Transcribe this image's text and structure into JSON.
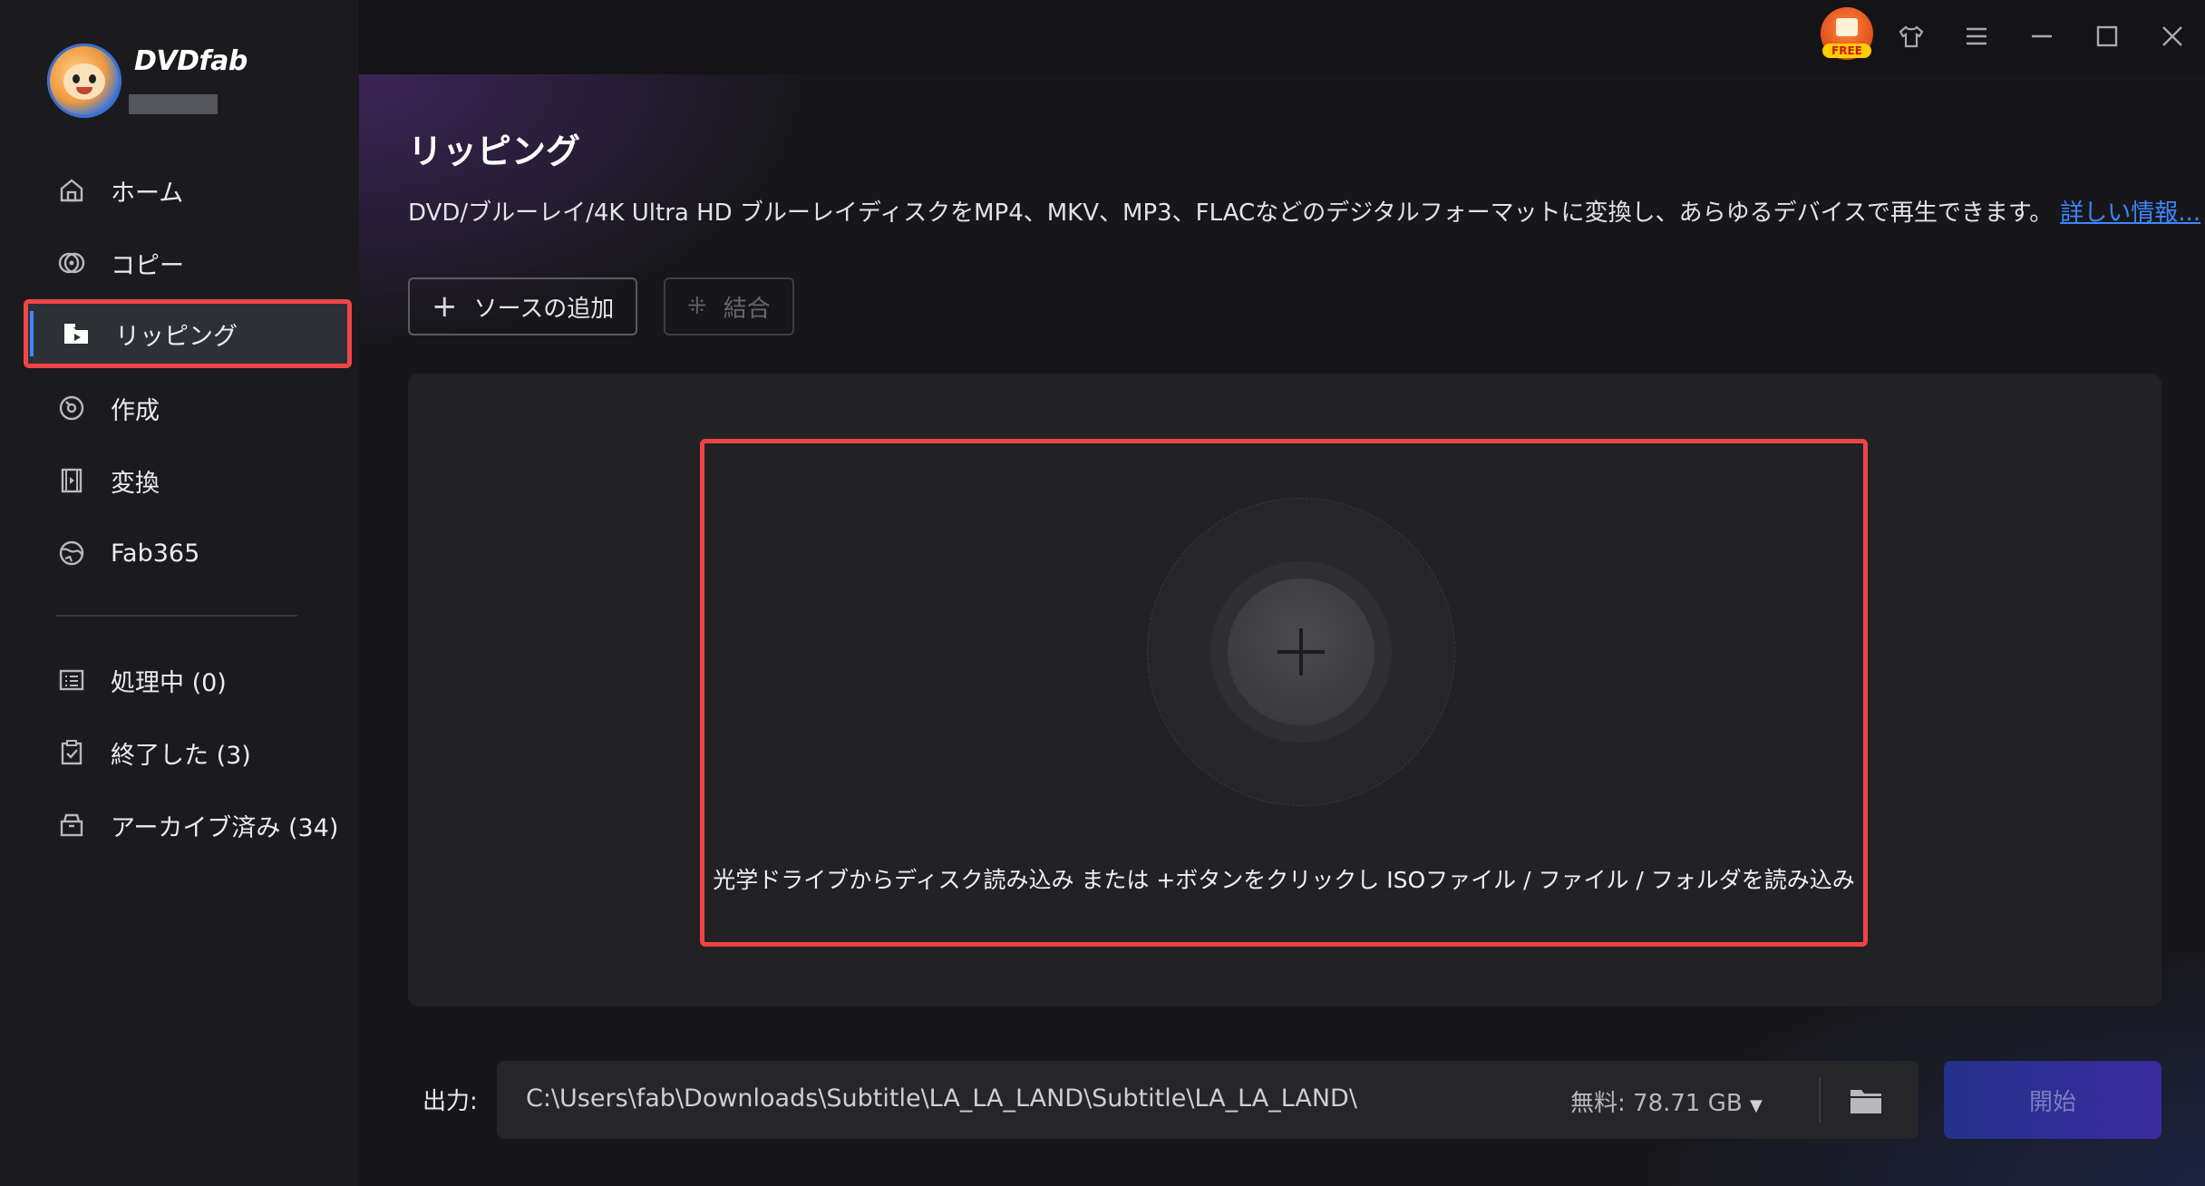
{
  "app": {
    "logo_text": "DVDfab"
  },
  "sidebar": {
    "items": [
      {
        "label": "ホーム",
        "icon": "home-icon"
      },
      {
        "label": "コピー",
        "icon": "copy-disc-icon"
      },
      {
        "label": "リッピング",
        "icon": "ripper-icon",
        "active": true
      },
      {
        "label": "作成",
        "icon": "creator-disc-icon"
      },
      {
        "label": "変換",
        "icon": "film-convert-icon"
      },
      {
        "label": "Fab365",
        "icon": "fab365-icon"
      }
    ],
    "queue": [
      {
        "label": "処理中 (0)",
        "icon": "task-list-icon"
      },
      {
        "label": "終了した (3)",
        "icon": "finished-clipboard-icon"
      },
      {
        "label": "アーカイブ済み (34)",
        "icon": "archive-box-icon"
      }
    ]
  },
  "topbar": {
    "free_badge": "FREE",
    "icons": [
      "free-gift-icon",
      "skin-shirt-icon",
      "menu-icon",
      "minimize-icon",
      "maximize-icon",
      "close-icon"
    ]
  },
  "main": {
    "title": "リッピング",
    "description": "DVD/ブルーレイ/4K Ultra HD ブルーレイディスクをMP4、MKV、MP3、FLACなどのデジタルフォーマットに変換し、あらゆるデバイスで再生できます。",
    "more_link": "詳しい情報...",
    "add_source_label": "ソースの追加",
    "merge_label": "結合",
    "drop_hint": "光学ドライブからディスク読み込み または +ボタンをクリックし ISOファイル / ファイル / フォルダを読み込み"
  },
  "output": {
    "label": "出力:",
    "path": "C:\\Users\\fab\\Downloads\\Subtitle\\LA_LA_LAND\\Subtitle\\LA_LA_LAND\\",
    "free_space": "無料: 78.71 GB",
    "start_label": "開始"
  },
  "colors": {
    "accent_blue": "#3d86ff",
    "highlight_red": "#ef4444",
    "start_button": "#2b2f8f"
  }
}
